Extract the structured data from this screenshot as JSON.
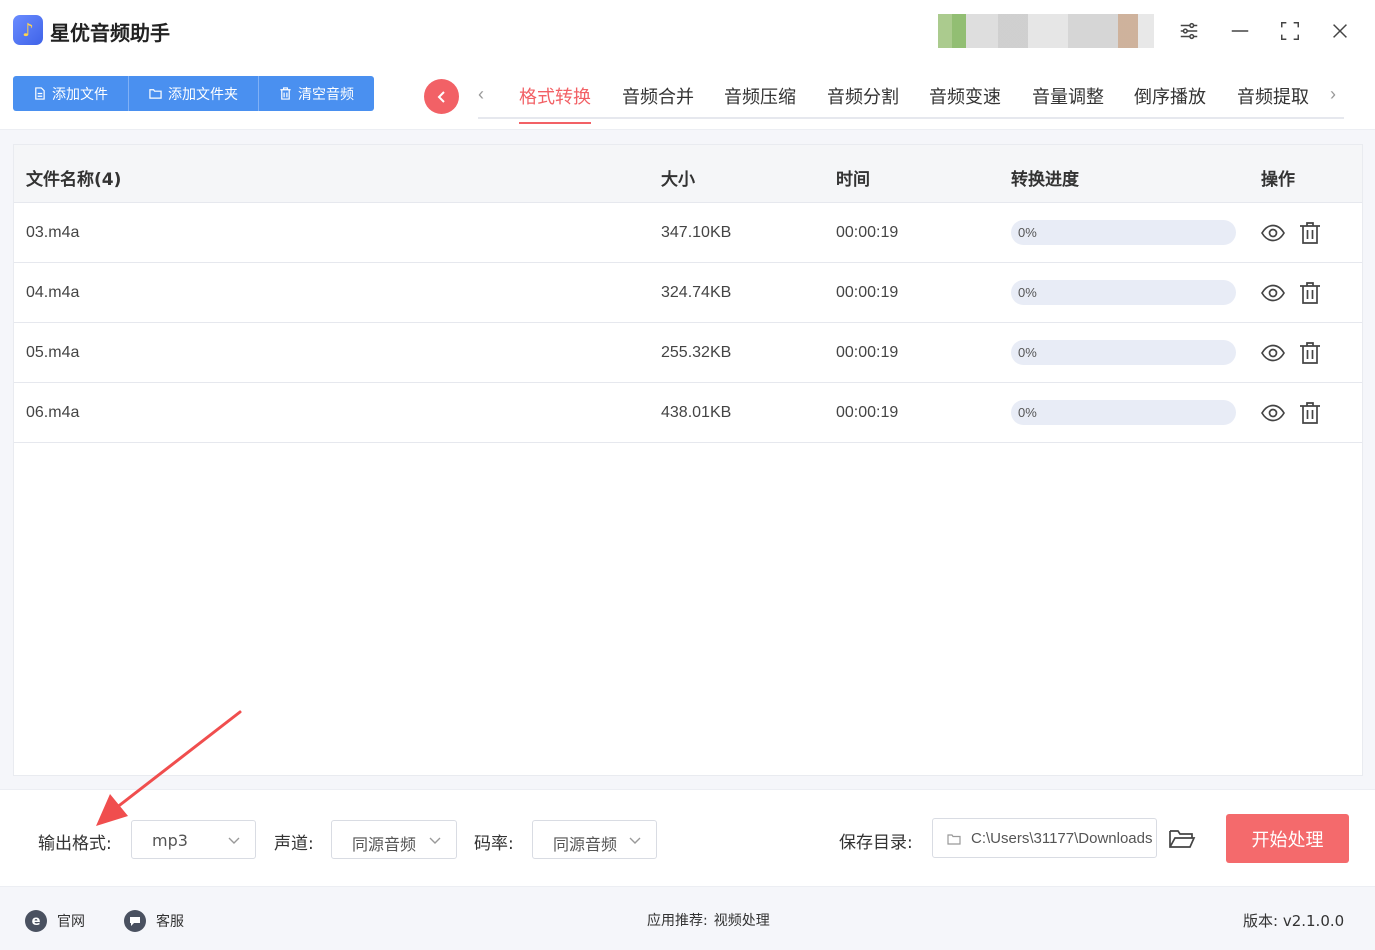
{
  "app": {
    "title": "星优音频助手",
    "logo_glyph": "♪"
  },
  "toolbar": {
    "add_file": "添加文件",
    "add_folder": "添加文件夹",
    "clear": "清空音频"
  },
  "tabs": [
    {
      "label": "格式转换",
      "active": true
    },
    {
      "label": "音频合并"
    },
    {
      "label": "音频压缩"
    },
    {
      "label": "音频分割"
    },
    {
      "label": "音频变速"
    },
    {
      "label": "音量调整"
    },
    {
      "label": "倒序播放"
    },
    {
      "label": "音频提取"
    }
  ],
  "table": {
    "headers": {
      "name": "文件名称(4)",
      "size": "大小",
      "time": "时间",
      "progress": "转换进度",
      "action": "操作"
    },
    "rows": [
      {
        "name": "03.m4a",
        "size": "347.10KB",
        "time": "00:00:19",
        "progress": 0,
        "progress_label": "0%"
      },
      {
        "name": "04.m4a",
        "size": "324.74KB",
        "time": "00:00:19",
        "progress": 0,
        "progress_label": "0%"
      },
      {
        "name": "05.m4a",
        "size": "255.32KB",
        "time": "00:00:19",
        "progress": 0,
        "progress_label": "0%"
      },
      {
        "name": "06.m4a",
        "size": "438.01KB",
        "time": "00:00:19",
        "progress": 0,
        "progress_label": "0%"
      }
    ]
  },
  "settings": {
    "format_label": "输出格式:",
    "format_value": "mp3",
    "channel_label": "声道:",
    "channel_value": "同源音频",
    "bitrate_label": "码率:",
    "bitrate_value": "同源音频",
    "save_label": "保存目录:",
    "save_path": "C:\\Users\\31177\\Downloads",
    "start_button": "开始处理"
  },
  "footer": {
    "website": "官网",
    "website_glyph": "e",
    "support": "客服",
    "recommend_label": "应用推荐:",
    "recommend_link": "视频处理",
    "version": "版本: v2.1.0.0"
  },
  "colors": {
    "accent": "#f26166",
    "primary_blue": "#4a90f0"
  }
}
